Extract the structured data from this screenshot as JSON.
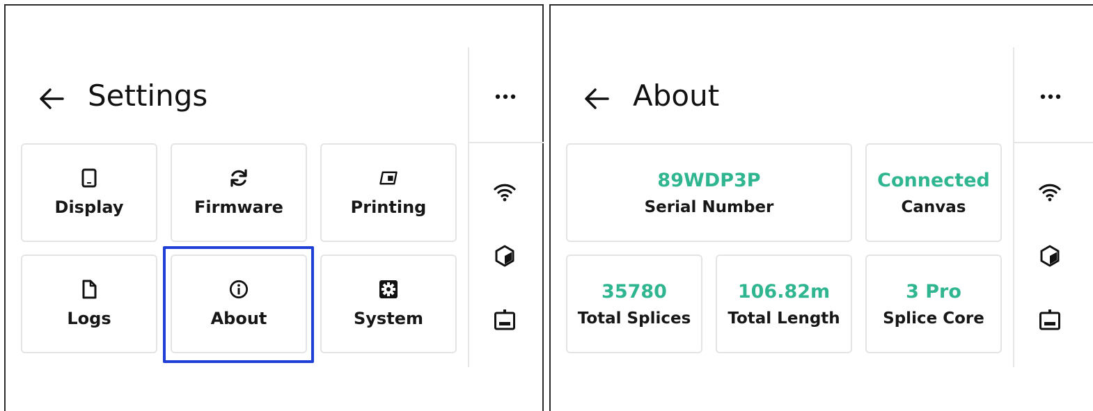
{
  "colors": {
    "accent": "#2fb58f",
    "highlight": "#1f3fd6",
    "text": "#111111",
    "tile_border": "#e4e4e4"
  },
  "settings_screen": {
    "title": "Settings",
    "tiles": [
      {
        "label": "Display",
        "icon": "tablet-icon"
      },
      {
        "label": "Firmware",
        "icon": "refresh-icon"
      },
      {
        "label": "Printing",
        "icon": "printer-icon"
      },
      {
        "label": "Logs",
        "icon": "file-icon"
      },
      {
        "label": "About",
        "icon": "info-icon"
      },
      {
        "label": "System",
        "icon": "gear-icon"
      }
    ],
    "highlighted_tile": "About"
  },
  "about_screen": {
    "title": "About",
    "stats": [
      {
        "value": "89WDP3P",
        "label": "Serial Number"
      },
      {
        "value": "Connected",
        "label": "Canvas"
      },
      {
        "value": "35780",
        "label": "Total Splices"
      },
      {
        "value": "106.82m",
        "label": "Total Length"
      },
      {
        "value": "3 Pro",
        "label": "Splice Core"
      }
    ]
  },
  "rail": {
    "icons": [
      "wifi-icon",
      "cube-icon",
      "printer-status-icon"
    ],
    "more": "more-icon"
  }
}
